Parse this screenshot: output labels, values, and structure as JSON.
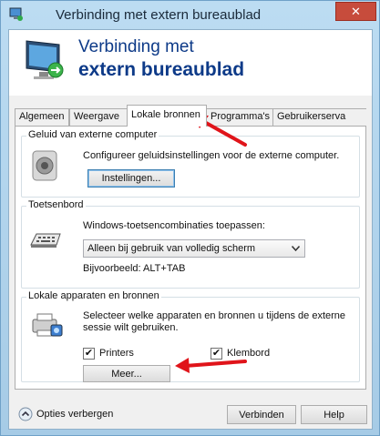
{
  "window": {
    "title": "Verbinding met extern bureaublad",
    "close_glyph": "✕"
  },
  "header": {
    "line1": "Verbinding met",
    "line2": "extern bureaublad"
  },
  "tabs": [
    {
      "label": "Algemeen"
    },
    {
      "label": "Weergave"
    },
    {
      "label": "Lokale bronnen"
    },
    {
      "label": "Programma's"
    },
    {
      "label": "Gebruikerserva"
    }
  ],
  "active_tab": "Lokale bronnen",
  "sound": {
    "legend": "Geluid van externe computer",
    "description": "Configureer geluidsinstellingen voor de externe computer.",
    "button_label": "Instellingen..."
  },
  "keyboard": {
    "legend": "Toetsenbord",
    "prompt": "Windows-toetsencombinaties toepassen:",
    "selected_option": "Alleen bij gebruik van volledig scherm",
    "example": "Bijvoorbeeld: ALT+TAB"
  },
  "local_devices": {
    "legend": "Lokale apparaten en bronnen",
    "description_line1": "Selecteer welke apparaten en bronnen u tijdens de externe",
    "description_line2": "sessie wilt gebruiken.",
    "printers_label": "Printers",
    "printers_checked": true,
    "clipboard_label": "Klembord",
    "clipboard_checked": true,
    "more_button_label": "Meer..."
  },
  "footer": {
    "options_label": "Opties verbergen",
    "connect_label": "Verbinden",
    "help_label": "Help"
  },
  "colors": {
    "arrow": "#e0141a",
    "title_blue": "#0d3a88"
  }
}
